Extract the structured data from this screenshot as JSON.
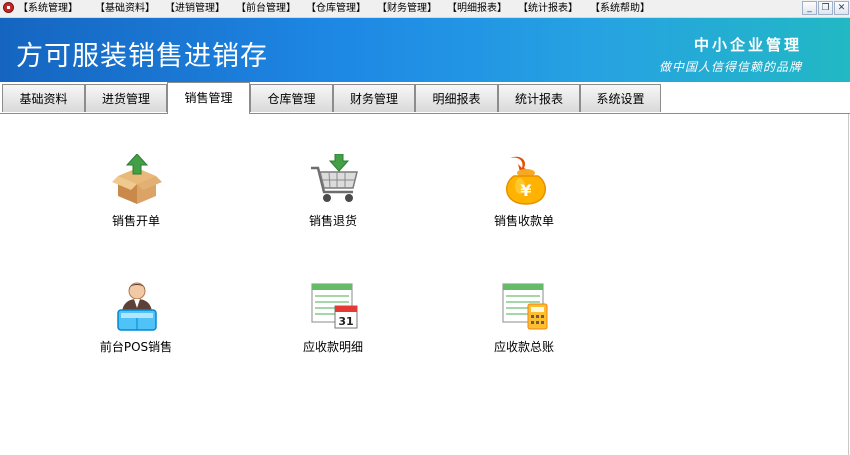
{
  "menubar": {
    "items": [
      "【系统管理】",
      "【基础资料】",
      "【进销管理】",
      "【前台管理】",
      "【仓库管理】",
      "【财务管理】",
      "【明细报表】",
      "【统计报表】",
      "【系统帮助】"
    ]
  },
  "window_controls": {
    "minimize": "_",
    "restore": "❐",
    "close": "✕"
  },
  "banner": {
    "title": "方可服装销售进销存",
    "brand_line1": "中小企业管理",
    "brand_line2": "做中国人信得信赖的品牌"
  },
  "tabs": [
    "基础资料",
    "进货管理",
    "销售管理",
    "仓库管理",
    "财务管理",
    "明细报表",
    "统计报表",
    "系统设置"
  ],
  "active_tab": "销售管理",
  "functions": [
    {
      "label": "销售开单",
      "icon": "box-upload-icon"
    },
    {
      "label": "销售退货",
      "icon": "cart-return-icon"
    },
    {
      "label": "销售收款单",
      "icon": "money-bag-icon"
    },
    {
      "label": "前台POS销售",
      "icon": "cashier-icon"
    },
    {
      "label": "应收款明细",
      "icon": "calendar-ledger-icon"
    },
    {
      "label": "应收款总账",
      "icon": "calculator-ledger-icon"
    }
  ],
  "colors": {
    "banner_start": "#1565c0",
    "banner_end": "#22b8c4",
    "accent_green": "#43a047"
  }
}
